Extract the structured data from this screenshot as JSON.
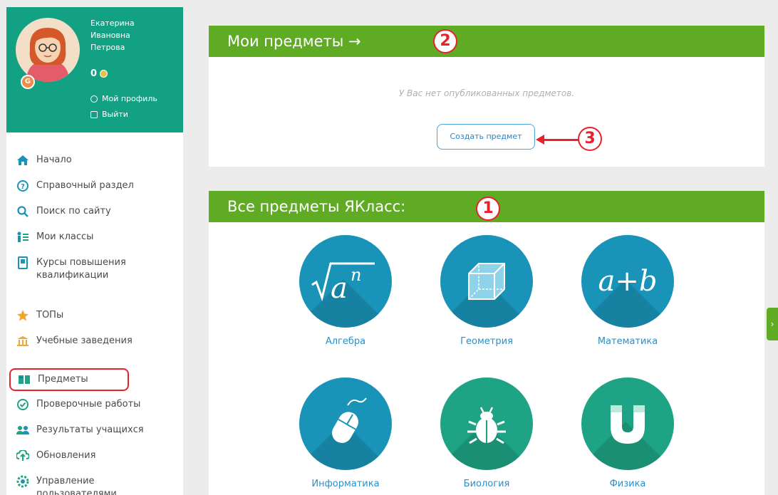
{
  "user": {
    "name_line1": "Екатерина",
    "name_line2": "Ивановна",
    "name_line3": "Петрова",
    "points": "0",
    "profile_link": "Мой профиль",
    "logout_link": "Выйти"
  },
  "nav": [
    {
      "label": "Начало",
      "icon": "home-icon"
    },
    {
      "label": "Справочный раздел",
      "icon": "help-icon"
    },
    {
      "label": "Поиск по сайту",
      "icon": "search-icon"
    },
    {
      "label": "Мои классы",
      "icon": "classes-icon"
    },
    {
      "label": "Курсы повышения квалификации",
      "icon": "courses-icon"
    },
    {
      "label": "ТОПы",
      "icon": "star-icon"
    },
    {
      "label": "Учебные заведения",
      "icon": "institution-icon"
    },
    {
      "label": "Предметы",
      "icon": "subjects-icon"
    },
    {
      "label": "Проверочные работы",
      "icon": "check-icon"
    },
    {
      "label": "Результаты учащихся",
      "icon": "students-icon"
    },
    {
      "label": "Обновления",
      "icon": "updates-icon"
    },
    {
      "label": "Управление пользователями",
      "icon": "users-manage-icon"
    }
  ],
  "my_subjects": {
    "title": "Мои предметы →",
    "empty_text": "У Вас нет опубликованных предметов.",
    "create_button": "Создать предмет"
  },
  "all_subjects": {
    "title": "Все предметы ЯКласс:",
    "items": [
      {
        "label": "Алгебра",
        "icon": "algebra-icon"
      },
      {
        "label": "Геометрия",
        "icon": "geometry-icon"
      },
      {
        "label": "Математика",
        "icon": "math-icon"
      },
      {
        "label": "Информатика",
        "icon": "computer-mouse-icon"
      },
      {
        "label": "Биология",
        "icon": "bug-icon"
      },
      {
        "label": "Физика",
        "icon": "magnet-icon"
      }
    ]
  },
  "markers": [
    "1",
    "2",
    "3"
  ],
  "colors": {
    "profile_bg": "#13a184",
    "header_green": "#5fac24",
    "subject_blue": "#1a93b8",
    "subject_green": "#1ea384",
    "marker_red": "#e8212b",
    "link_blue": "#2c8fc4"
  }
}
